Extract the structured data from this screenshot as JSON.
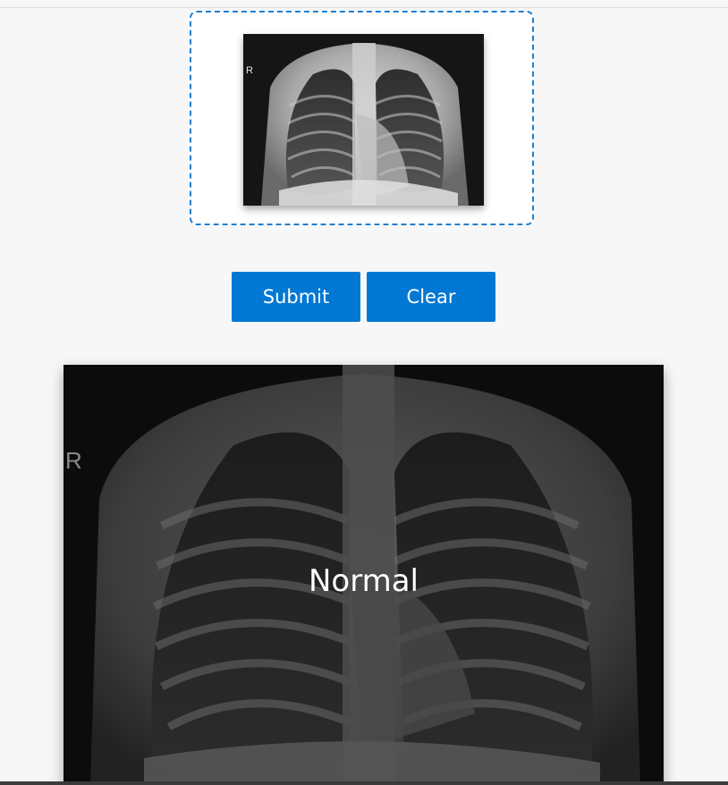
{
  "upload": {
    "thumbnail_marker": "R"
  },
  "buttons": {
    "submit_label": "Submit",
    "clear_label": "Clear"
  },
  "result": {
    "marker": "R",
    "prediction_label": "Normal"
  },
  "colors": {
    "accent": "#0078d4",
    "dropzone_border": "#1f7fd0",
    "background": "#f7f7f7"
  }
}
